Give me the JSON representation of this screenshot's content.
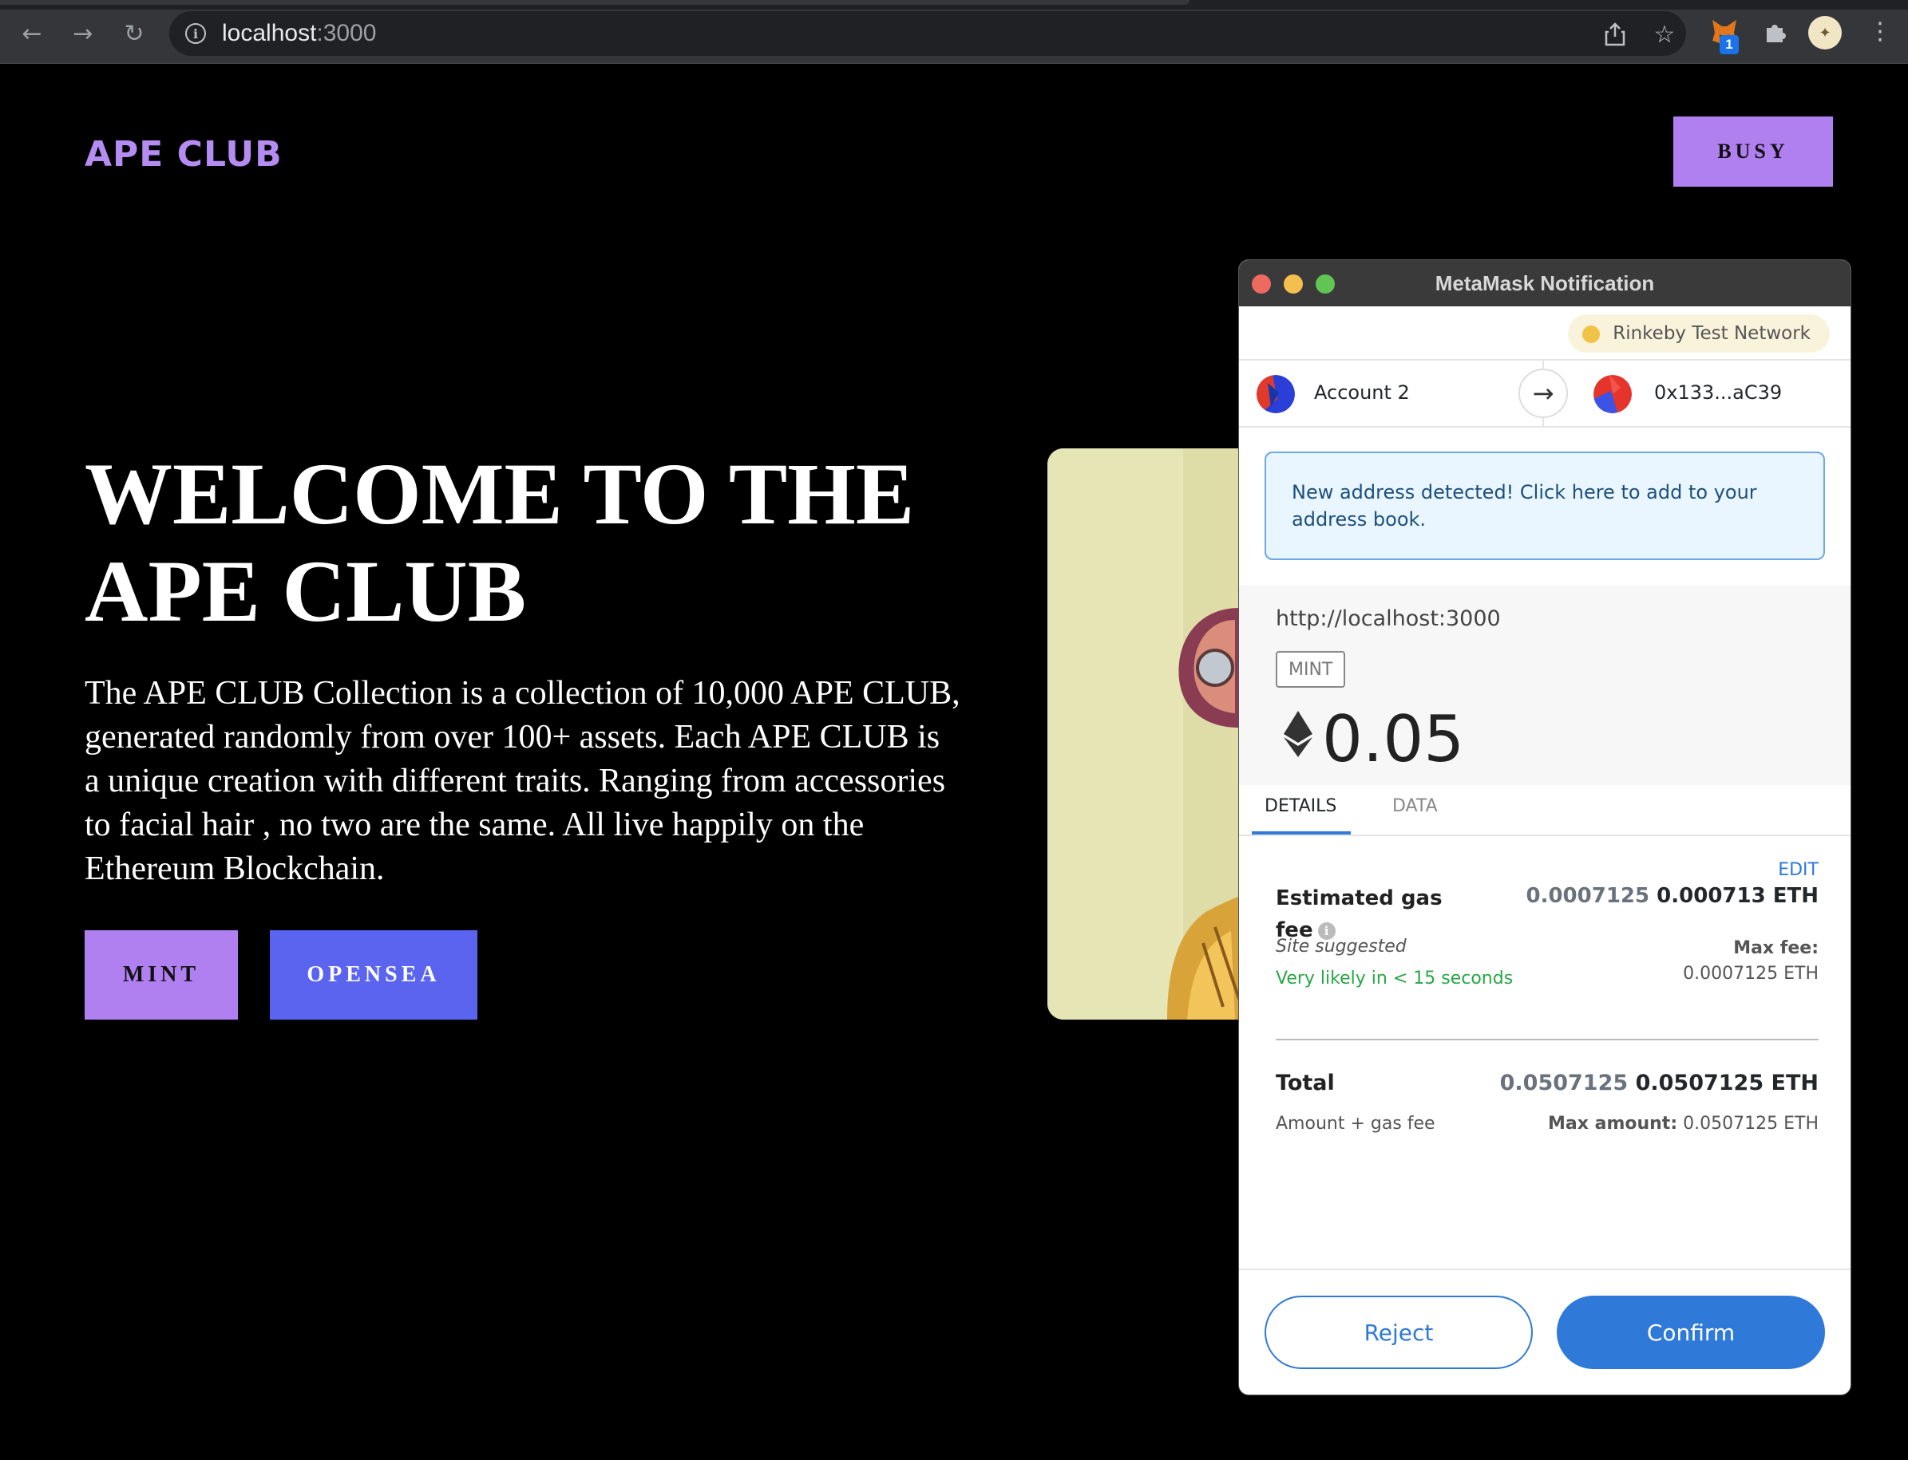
{
  "browser": {
    "url_host": "localhost",
    "url_port": ":3000",
    "extension_badge": "1"
  },
  "page": {
    "brand": "APE CLUB",
    "wallet_button": "BUSY",
    "hero_title": "WELCOME TO THE APE CLUB",
    "hero_description": "The APE CLUB Collection is a collection of 10,000 APE CLUB, generated randomly from over 100+ assets. Each APE CLUB is a unique creation with different traits. Ranging from accessories to facial hair , no two are the same. All live happily on the Ethereum Blockchain.",
    "mint_button": "MINT",
    "opensea_button": "OPENSEA",
    "colors": {
      "accent_purple": "#b07ff0",
      "opensea_blue": "#5a64ef",
      "background": "#000000"
    }
  },
  "metamask": {
    "window_title": "MetaMask Notification",
    "network": "Rinkeby Test Network",
    "from_account": "Account 2",
    "to_address": "0x133...aC39",
    "notice": "New address detected! Click here to add to your address book.",
    "origin": "http://localhost:3000",
    "method": "MINT",
    "amount": "0.05",
    "tabs": {
      "details": "DETAILS",
      "data": "DATA"
    },
    "edit": "EDIT",
    "gas": {
      "label": "Estimated gas fee",
      "value_muted": "0.0007125",
      "value": "0.000713 ETH",
      "site_suggested": "Site suggested",
      "likely": "Very likely in < 15 seconds",
      "max_fee_label": "Max fee:",
      "max_fee_value": "0.0007125 ETH"
    },
    "total": {
      "label": "Total",
      "value_muted": "0.0507125",
      "value": "0.0507125 ETH",
      "sub_label": "Amount + gas fee",
      "max_amount_label": "Max amount:",
      "max_amount_value": "0.0507125 ETH"
    },
    "reject_button": "Reject",
    "confirm_button": "Confirm",
    "colors": {
      "primary": "#2f79d8",
      "success": "#28a745"
    }
  }
}
